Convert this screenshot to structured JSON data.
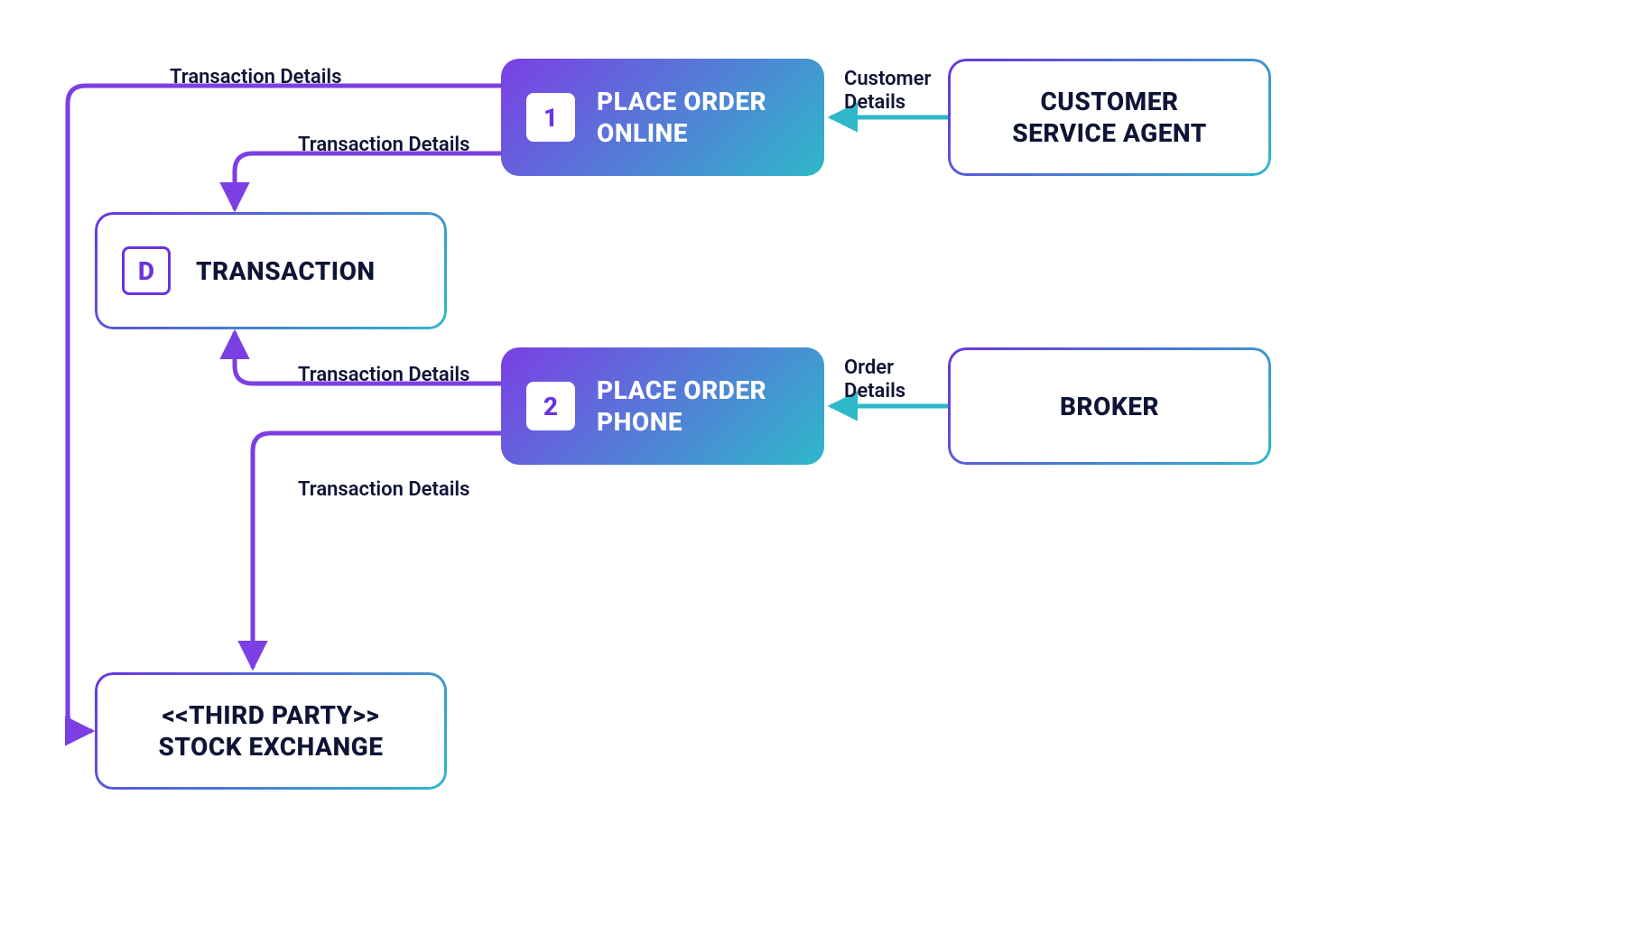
{
  "processes": {
    "p1": {
      "num": "1",
      "title": "PLACE ORDER ONLINE"
    },
    "p2": {
      "num": "2",
      "title": "PLACE ORDER PHONE"
    }
  },
  "entities": {
    "csa": {
      "title": "CUSTOMER SERVICE AGENT"
    },
    "broker": {
      "title": "BROKER"
    },
    "stock_exchange": {
      "line1": "<<THIRD PARTY>>",
      "line2": "STOCK EXCHANGE"
    }
  },
  "datastore": {
    "badge": "D",
    "title": "TRANSACTION"
  },
  "flows": {
    "csa_to_p1": "Customer Details",
    "broker_to_p2": "Order Details",
    "p1_to_transaction": "Transaction Details",
    "p2_to_transaction": "Transaction Details",
    "p1_to_stock_exchange": "Transaction Details",
    "p2_to_stock_exchange": "Transaction Details"
  },
  "colors": {
    "purple": "#7B3FE4",
    "teal": "#2EB8C9",
    "dark": "#0F1436"
  }
}
